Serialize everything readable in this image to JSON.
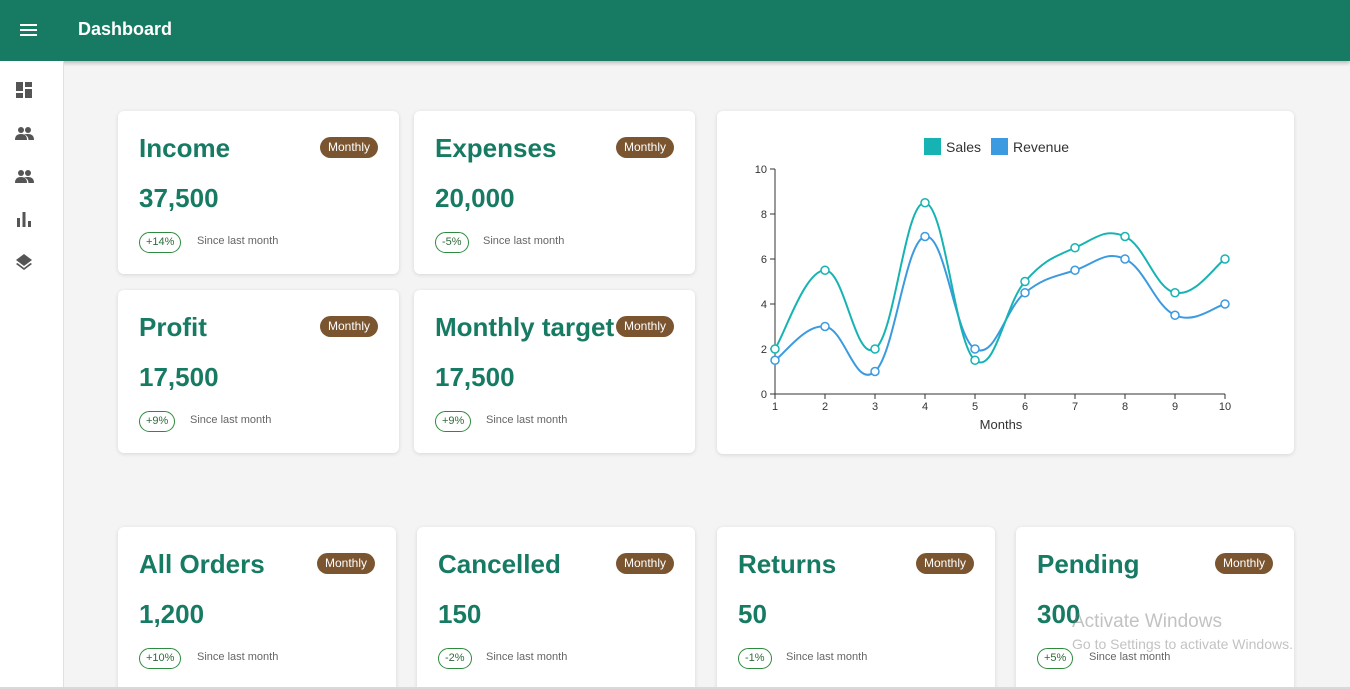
{
  "header": {
    "title": "Dashboard"
  },
  "sidebar": {
    "items": [
      {
        "icon": "dashboard-icon"
      },
      {
        "icon": "people-icon"
      },
      {
        "icon": "people-icon"
      },
      {
        "icon": "bar-chart-icon"
      },
      {
        "icon": "layers-icon"
      }
    ]
  },
  "colors": {
    "primary": "#177b63",
    "badge": "#7a5530",
    "sales": "#17b3b3",
    "revenue": "#3b9ae0"
  },
  "cards": {
    "income": {
      "title": "Income",
      "badge": "Monthly",
      "value": "37,500",
      "change": "+14%",
      "since": "Since last month"
    },
    "expenses": {
      "title": "Expenses",
      "badge": "Monthly",
      "value": "20,000",
      "change": "-5%",
      "since": "Since last month"
    },
    "profit": {
      "title": "Profit",
      "badge": "Monthly",
      "value": "17,500",
      "change": "+9%",
      "since": "Since last month"
    },
    "target": {
      "title": "Monthly target",
      "badge": "Monthly",
      "value": "17,500",
      "change": "+9%",
      "since": "Since last month"
    },
    "orders": {
      "title": "All Orders",
      "badge": "Monthly",
      "value": "1,200",
      "change": "+10%",
      "since": "Since last month"
    },
    "cancelled": {
      "title": "Cancelled",
      "badge": "Monthly",
      "value": "150",
      "change": "-2%",
      "since": "Since last month"
    },
    "returns": {
      "title": "Returns",
      "badge": "Monthly",
      "value": "50",
      "change": "-1%",
      "since": "Since last month"
    },
    "pending": {
      "title": "Pending",
      "badge": "Monthly",
      "value": "300",
      "change": "+5%",
      "since": "Since last month"
    }
  },
  "chart_data": {
    "type": "line",
    "x": [
      1,
      2,
      3,
      4,
      5,
      6,
      7,
      8,
      9,
      10
    ],
    "xticks": [
      "1",
      "2",
      "3",
      "4",
      "5",
      "6",
      "7",
      "8",
      "9",
      "10"
    ],
    "yticks": [
      "0",
      "2",
      "4",
      "6",
      "8",
      "10"
    ],
    "ylim": [
      0,
      10
    ],
    "xlabel": "Months",
    "ylabel": "",
    "legend": "top-center",
    "grid": false,
    "series": [
      {
        "name": "Sales",
        "color": "#17b3b3",
        "values": [
          2,
          5.5,
          2,
          8.5,
          1.5,
          5,
          6.5,
          7,
          4.5,
          6
        ]
      },
      {
        "name": "Revenue",
        "color": "#3b9ae0",
        "values": [
          1.5,
          3,
          1,
          7,
          2,
          4.5,
          5.5,
          6,
          3.5,
          4
        ]
      }
    ]
  },
  "watermark": {
    "line1": "Activate Windows",
    "line2": "Go to Settings to activate Windows."
  }
}
